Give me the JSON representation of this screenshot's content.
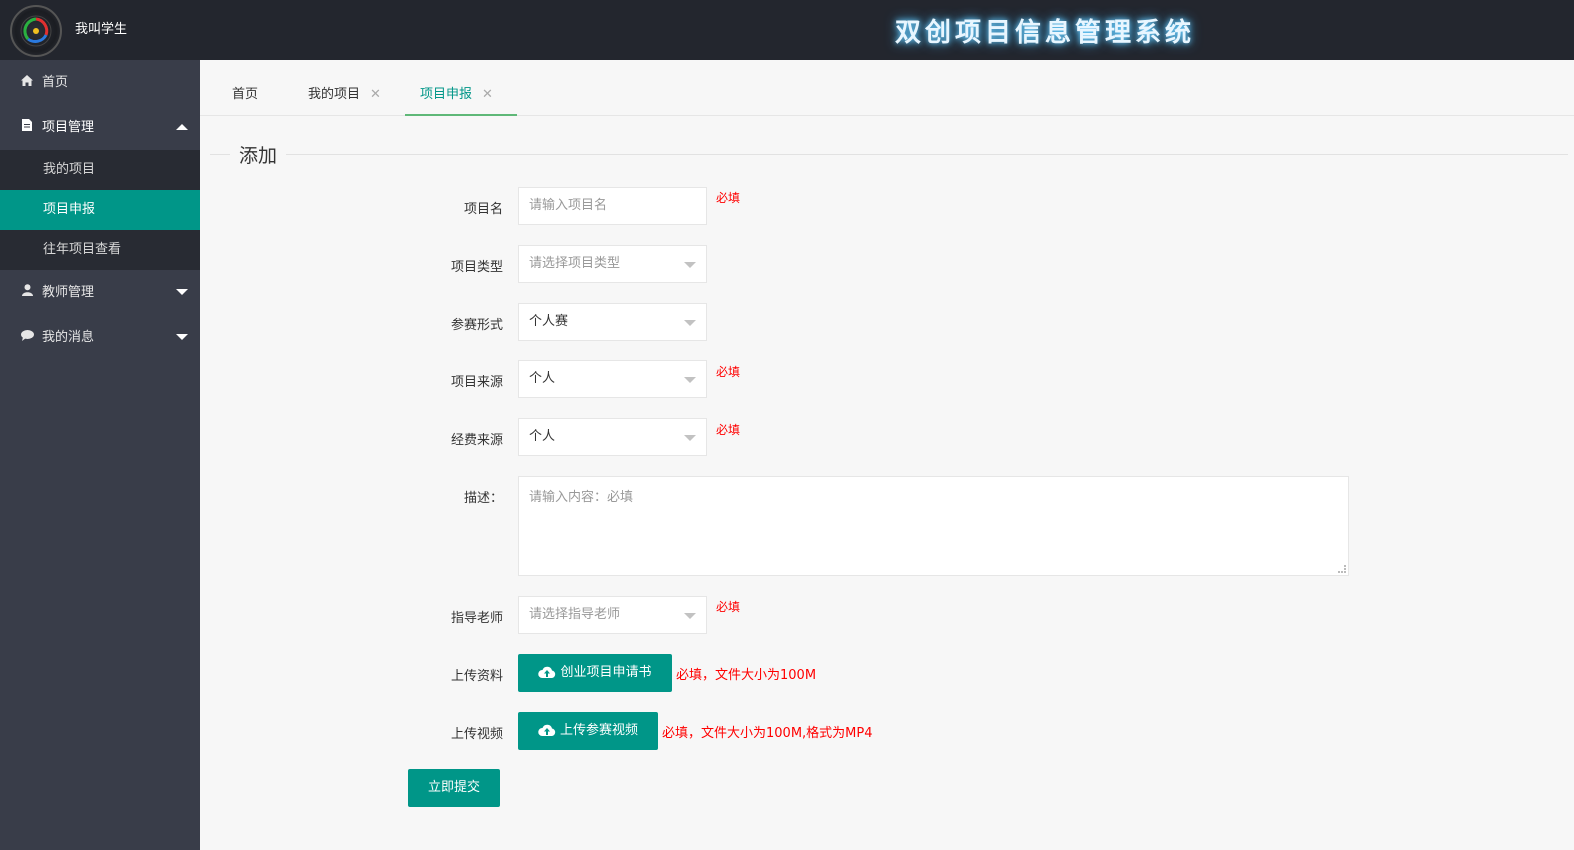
{
  "header": {
    "username": "我叫学生",
    "system_title": "双创项目信息管理系统"
  },
  "sidebar": {
    "home": {
      "label": "首页",
      "icon": "home-icon"
    },
    "project_mgmt": {
      "label": "项目管理",
      "icon": "document-icon",
      "items": [
        {
          "label": "我的项目"
        },
        {
          "label": "项目申报"
        },
        {
          "label": "往年项目查看"
        }
      ]
    },
    "teacher_mgmt": {
      "label": "教师管理",
      "icon": "user-icon"
    },
    "messages": {
      "label": "我的消息",
      "icon": "chat-bubble-icon"
    }
  },
  "tabs": [
    {
      "label": "首页"
    },
    {
      "label": "我的项目"
    },
    {
      "label": "项目申报"
    }
  ],
  "form": {
    "title": "添加",
    "project_name": {
      "label": "项目名",
      "placeholder": "请输入项目名",
      "required": "必填"
    },
    "project_type": {
      "label": "项目类型",
      "placeholder": "请选择项目类型"
    },
    "competition_form": {
      "label": "参赛形式",
      "value": "个人赛"
    },
    "project_source": {
      "label": "项目来源",
      "value": "个人",
      "required": "必填"
    },
    "funding_source": {
      "label": "经费来源",
      "value": "个人",
      "required": "必填"
    },
    "description": {
      "label": "描述：",
      "placeholder": "请输入内容：必填"
    },
    "advisor": {
      "label": "指导老师",
      "placeholder": "请选择指导老师",
      "required": "必填"
    },
    "upload_material": {
      "label": "上传资料",
      "button": "创业项目申请书",
      "note": "必填，文件大小为100M"
    },
    "upload_video": {
      "label": "上传视频",
      "button": "上传参赛视频",
      "note": "必填，文件大小为100M,格式为MP4"
    },
    "submit": "立即提交"
  },
  "colors": {
    "accent": "#009688",
    "sidebar": "#393d49",
    "header": "#23262e",
    "required": "#ff0000"
  }
}
